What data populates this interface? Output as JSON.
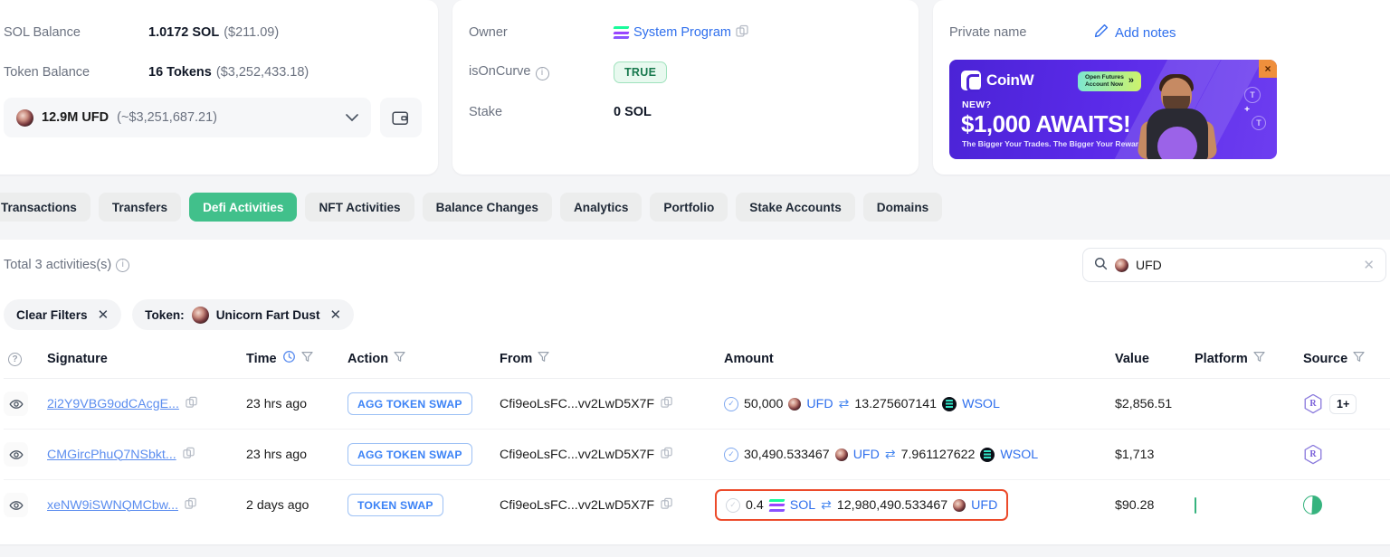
{
  "account": {
    "sol_balance_label": "SOL Balance",
    "sol_balance_value": "1.0172 SOL",
    "sol_balance_usd": "($211.09)",
    "token_balance_label": "Token Balance",
    "token_balance_value": "16 Tokens",
    "token_balance_usd": "($3,252,433.18)",
    "selected_token": "12.9M UFD",
    "selected_token_usd": "(~$3,251,687.21)"
  },
  "details": {
    "owner_label": "Owner",
    "owner_value": "System Program",
    "is_on_curve_label": "isOnCurve",
    "is_on_curve_value": "TRUE",
    "stake_label": "Stake",
    "stake_value": "0 SOL"
  },
  "notes": {
    "private_name_label": "Private name",
    "add_notes_label": "Add notes"
  },
  "banner": {
    "brand": "CoinW",
    "cta_line1": "Open Futures",
    "cta_line2": "Account Now",
    "cta_arrows": "»",
    "eyebrow": "NEW?",
    "headline": "$1,000 AWAITS!",
    "subline": "The Bigger Your Trades. The Bigger Your Rewards!",
    "close": "×"
  },
  "tabs": [
    {
      "label": "Transactions",
      "active": false
    },
    {
      "label": "Transfers",
      "active": false
    },
    {
      "label": "Defi Activities",
      "active": true
    },
    {
      "label": "NFT Activities",
      "active": false
    },
    {
      "label": "Balance Changes",
      "active": false
    },
    {
      "label": "Analytics",
      "active": false
    },
    {
      "label": "Portfolio",
      "active": false
    },
    {
      "label": "Stake Accounts",
      "active": false
    },
    {
      "label": "Domains",
      "active": false
    }
  ],
  "toolbar": {
    "total_text": "Total 3 activities(s)",
    "search_value": "UFD",
    "clear_filters_label": "Clear Filters",
    "token_filter_prefix": "Token:",
    "token_filter_name": "Unicorn Fart Dust"
  },
  "table": {
    "columns": [
      "Signature",
      "Time",
      "Action",
      "From",
      "Amount",
      "Value",
      "Platform",
      "Source"
    ],
    "rows": [
      {
        "signature": "2i2Y9VBG9odCAcgE...",
        "time": "23 hrs ago",
        "action": "AGG TOKEN SWAP",
        "from": "Cfi9eoLsFC...vv2LwD5X7F",
        "amount_in": "50,000",
        "amount_in_token": "UFD",
        "amount_out": "13.275607141",
        "amount_out_token": "WSOL",
        "value": "$2,856.51",
        "platform": "orbit-icon",
        "source": "raydium-icon",
        "source_extra": "1+",
        "highlight": false
      },
      {
        "signature": "CMGircPhuQ7NSbkt...",
        "time": "23 hrs ago",
        "action": "AGG TOKEN SWAP",
        "from": "Cfi9eoLsFC...vv2LwD5X7F",
        "amount_in": "30,490.533467",
        "amount_in_token": "UFD",
        "amount_out": "7.961127622",
        "amount_out_token": "WSOL",
        "value": "$1,713",
        "platform": "orbit-icon",
        "source": "raydium-icon",
        "source_extra": "",
        "highlight": false
      },
      {
        "signature": "xeNW9iSWNQMCbw...",
        "time": "2 days ago",
        "action": "TOKEN SWAP",
        "from": "Cfi9eoLsFC...vv2LwD5X7F",
        "amount_in": "0.4",
        "amount_in_token": "SOL",
        "amount_out": "12,980,490.533467",
        "amount_out_token": "UFD",
        "value": "$90.28",
        "platform": "pill-icon",
        "source": "pill-icon",
        "source_extra": "",
        "highlight": true
      }
    ]
  },
  "colors": {
    "accent_green": "#41c08b",
    "link_blue": "#2f6fed",
    "highlight_red": "#ec4a2a",
    "banner_purple": "#5a2ae8"
  }
}
